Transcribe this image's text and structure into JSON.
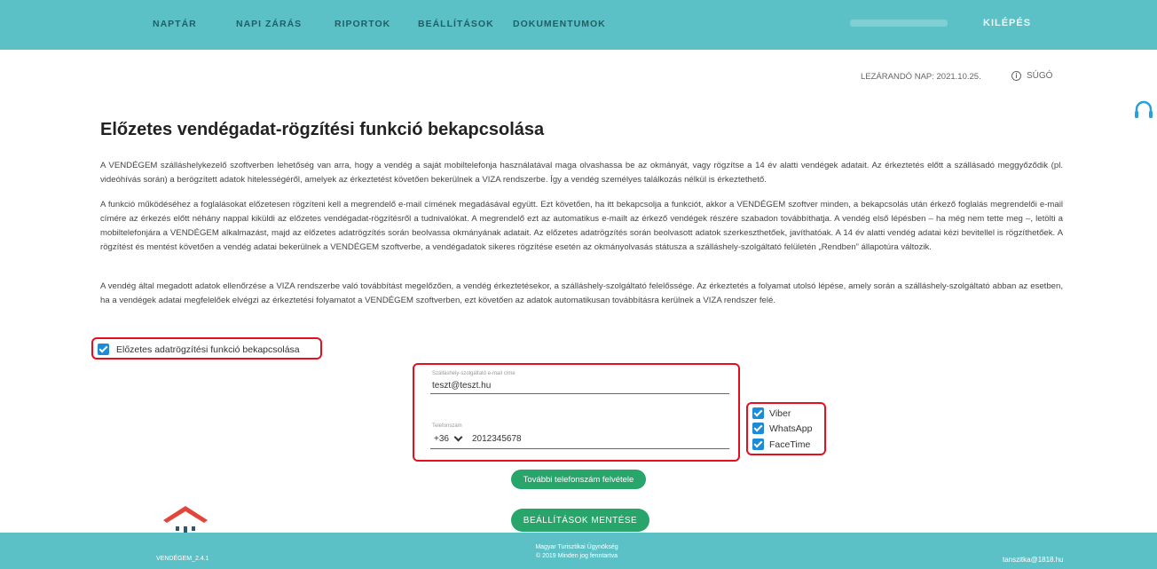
{
  "nav": {
    "items": [
      "NAPTÁR",
      "NAPI ZÁRÁS",
      "RIPORTOK",
      "BEÁLLÍTÁSOK",
      "DOKUMENTUMOK"
    ],
    "logout": "KILÉPÉS"
  },
  "status": {
    "closing_day": "LEZÁRANDÓ NAP: 2021.10.25.",
    "help": "SÚGÓ"
  },
  "page": {
    "title": "Előzetes vendégadat-rögzítési funkció bekapcsolása",
    "paragraphs": [
      "A VENDÉGEM szálláshelykezelő szoftverben lehetőség van arra, hogy a vendég a saját mobiltelefonja használatával maga olvashassa be az okmányát, vagy rögzítse a 14 év alatti vendégek adatait. Az érkeztetés előtt a szállásadó meggyőződik (pl. videóhívás során) a berögzített adatok hitelességéről, amelyek az érkeztetést követően bekerülnek a VIZA rendszerbe. Így a vendég személyes találkozás nélkül is érkeztethető.",
      "A funkció működéséhez a foglalásokat előzetesen rögzíteni kell a megrendelő e-mail címének megadásával együtt. Ezt követően, ha itt bekapcsolja a funkciót, akkor a VENDÉGEM szoftver minden, a bekapcsolás után érkező foglalás megrendelői e-mail címére az érkezés előtt néhány nappal kiküldi az előzetes vendégadat-rögzítésről a tudnivalókat. A megrendelő ezt az automatikus e-mailt az érkező vendégek részére szabadon továbbíthatja. A vendég első lépésben – ha még nem tette meg –, letölti a mobiltelefonjára a VENDÉGEM alkalmazást, majd az előzetes adatrögzítés során beolvassa okmányának adatait. Az előzetes adatrögzítés során beolvasott adatok szerkeszthetőek, javíthatóak. A 14 év alatti vendég adatai kézi bevitellel is rögzíthetőek. A rögzítést és mentést követően a vendég adatai bekerülnek a VENDÉGEM szoftverbe, a vendégadatok sikeres rögzítése esetén az okmányolvasás státusza a szálláshely-szolgáltató felületén „Rendben” állapotúra változik.",
      "A vendég által megadott adatok ellenőrzése a VIZA rendszerbe való továbbítást megelőzően, a vendég érkeztetésekor, a szálláshely-szolgáltató felelőssége. Az érkeztetés a folyamat utolsó lépése, amely során a szálláshely-szolgáltató abban az esetben, ha a vendégek adatai megfelelőek elvégzi az érkeztetési folyamatot a VENDÉGEM szoftverben, ezt követően az adatok automatikusan továbbításra kerülnek a VIZA rendszer felé."
    ],
    "enable_checkbox_label": "Előzetes adatrögzítési funkció bekapcsolása"
  },
  "form": {
    "email_label": "Szálláshely-szolgáltató e-mail címe",
    "email_value": "teszt@teszt.hu",
    "phone_label": "Telefonszám",
    "dial_code": "+36",
    "phone_value": "2012345678",
    "apps": [
      "Viber",
      "WhatsApp",
      "FaceTime"
    ],
    "add_phone_button": "További telefonszám felvétele",
    "save_button": "BEÁLLÍTÁSOK MENTÉSE"
  },
  "footer": {
    "version": "VENDÉGEM_2.4.1",
    "org_line1": "Magyar Turisztikai Ügynökség",
    "org_line2": "© 2019 Minden jog fenntartva",
    "email": "tanszitka@1818.hu"
  },
  "colors": {
    "header": "#5cc1c6",
    "button": "#27a56a",
    "highlight": "#e4101f",
    "checkbox": "#1d8bd6"
  }
}
